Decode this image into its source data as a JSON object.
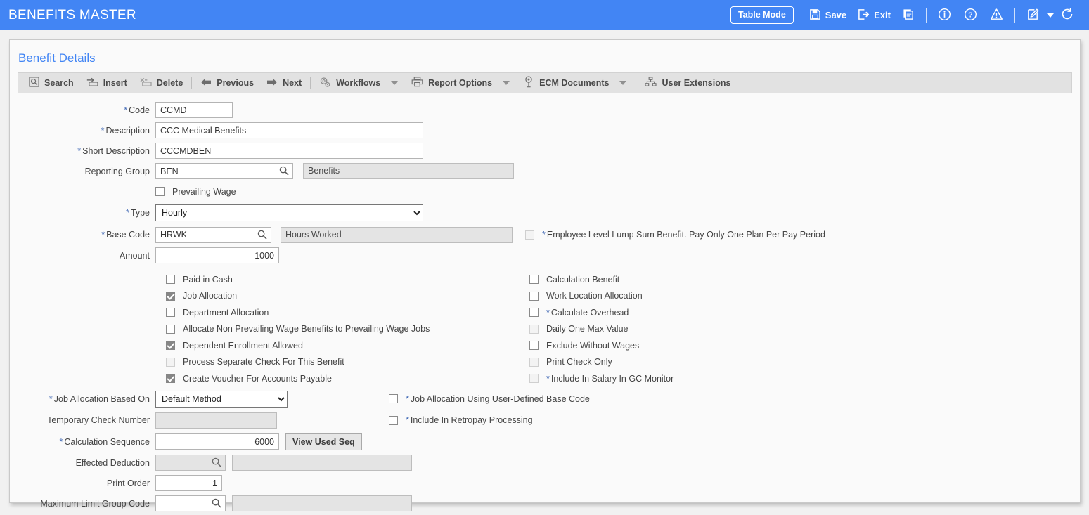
{
  "header": {
    "title": "BENEFITS MASTER",
    "table_mode_label": "Table Mode",
    "save_label": "Save",
    "exit_label": "Exit",
    "accent_color": "#4285f4"
  },
  "card": {
    "title": "Benefit Details"
  },
  "toolbar": {
    "search": "Search",
    "insert": "Insert",
    "delete": "Delete",
    "previous": "Previous",
    "next": "Next",
    "workflows": "Workflows",
    "report_options": "Report Options",
    "ecm_documents": "ECM Documents",
    "user_extensions": "User Extensions"
  },
  "form": {
    "code": {
      "label": "Code",
      "value": "CCMD"
    },
    "description": {
      "label": "Description",
      "value": "CCC Medical Benefits"
    },
    "short_description": {
      "label": "Short Description",
      "value": "CCCMDBEN"
    },
    "reporting_group": {
      "label": "Reporting Group",
      "value": "BEN",
      "desc": "Benefits"
    },
    "type": {
      "label": "Type",
      "value": "Hourly"
    },
    "base_code": {
      "label": "Base Code",
      "value": "HRWK",
      "desc": "Hours Worked"
    },
    "amount": {
      "label": "Amount",
      "value": "1000"
    },
    "job_allocation_based_on": {
      "label": "Job Allocation Based On",
      "value": "Default Method"
    },
    "temporary_check_number": {
      "label": "Temporary Check Number",
      "value": ""
    },
    "calculation_sequence": {
      "label": "Calculation Sequence",
      "value": "6000",
      "button": "View Used Seq"
    },
    "effected_deduction": {
      "label": "Effected Deduction",
      "value": "",
      "desc": ""
    },
    "print_order": {
      "label": "Print Order",
      "value": "1"
    },
    "maximum_limit_group_code": {
      "label": "Maximum Limit Group Code",
      "value": "",
      "desc": ""
    }
  },
  "checkboxes": {
    "prevailing_wage": "Prevailing Wage",
    "employee_lump_sum": "Employee Level Lump Sum Benefit. Pay Only One Plan Per Pay Period",
    "left": [
      "Paid in Cash",
      "Job Allocation",
      "Department Allocation",
      "Allocate Non Prevailing Wage Benefits to Prevailing Wage Jobs",
      "Dependent Enrollment Allowed",
      "Process Separate Check For This Benefit",
      "Create Voucher For Accounts Payable"
    ],
    "right": [
      "Calculation Benefit",
      "Work Location Allocation",
      "Calculate Overhead",
      "Daily One Max Value",
      "Exclude Without Wages",
      "Print Check Only",
      "Include In Salary In GC Monitor"
    ],
    "right_lower": [
      "Job Allocation Using User-Defined Base Code",
      "Include In Retropay Processing"
    ]
  },
  "options": {
    "type": [
      "Hourly"
    ],
    "job_allocation_based_on": [
      "Default Method"
    ]
  }
}
